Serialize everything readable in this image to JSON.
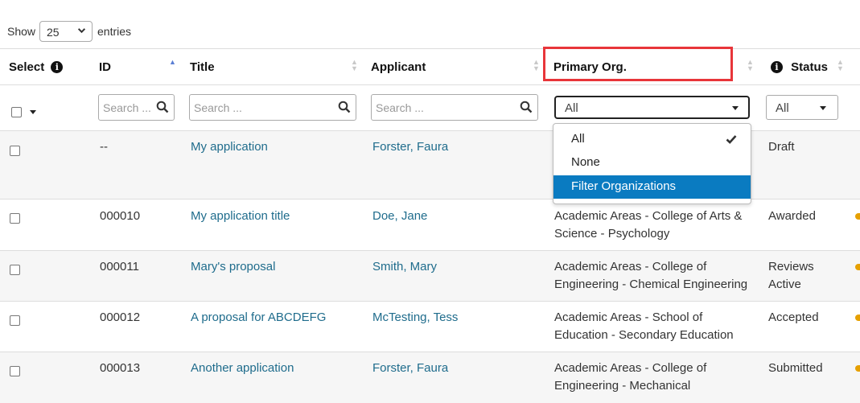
{
  "length_control": {
    "show_label": "Show",
    "value": "25",
    "entries_label": "entries"
  },
  "columns": {
    "select": "Select",
    "id": "ID",
    "title": "Title",
    "applicant": "Applicant",
    "primary_org": "Primary Org.",
    "status": "Status"
  },
  "filters": {
    "id_placeholder": "Search ...",
    "title_placeholder": "Search ...",
    "applicant_placeholder": "Search ...",
    "org_value": "All",
    "status_value": "All"
  },
  "org_dropdown": {
    "options": [
      "All",
      "None",
      "Filter Organizations"
    ],
    "checked": "All",
    "highlighted": "Filter Organizations"
  },
  "rows": [
    {
      "id": "--",
      "title": "My application",
      "applicant": "Forster, Faura",
      "org_line1": "",
      "org_line2": "",
      "status_line1": "Draft",
      "status_line2": ""
    },
    {
      "id": "000010",
      "title": "My application title",
      "applicant": "Doe, Jane",
      "org_line1": "Academic Areas - College of Arts &",
      "org_line2": "Science - Psychology",
      "status_line1": "Awarded",
      "status_line2": ""
    },
    {
      "id": "000011",
      "title": "Mary's proposal",
      "applicant": "Smith, Mary",
      "org_line1": "Academic Areas - College of",
      "org_line2": "Engineering - Chemical Engineering",
      "status_line1": "Reviews",
      "status_line2": "Active"
    },
    {
      "id": "000012",
      "title": "A proposal for ABCDEFG",
      "applicant": "McTesting, Tess",
      "org_line1": "Academic Areas - School of",
      "org_line2": "Education - Secondary Education",
      "status_line1": "Accepted",
      "status_line2": ""
    },
    {
      "id": "000013",
      "title": "Another application",
      "applicant": "Forster, Faura",
      "org_line1": "Academic Areas - College of",
      "org_line2": "Engineering - Mechanical",
      "status_line1": "Submitted",
      "status_line2": ""
    }
  ],
  "colors": {
    "link": "#1f6c8c",
    "highlight_border": "#e8353a",
    "dropdown_active": "#0a7bc1",
    "row_alt": "#f6f6f6"
  }
}
